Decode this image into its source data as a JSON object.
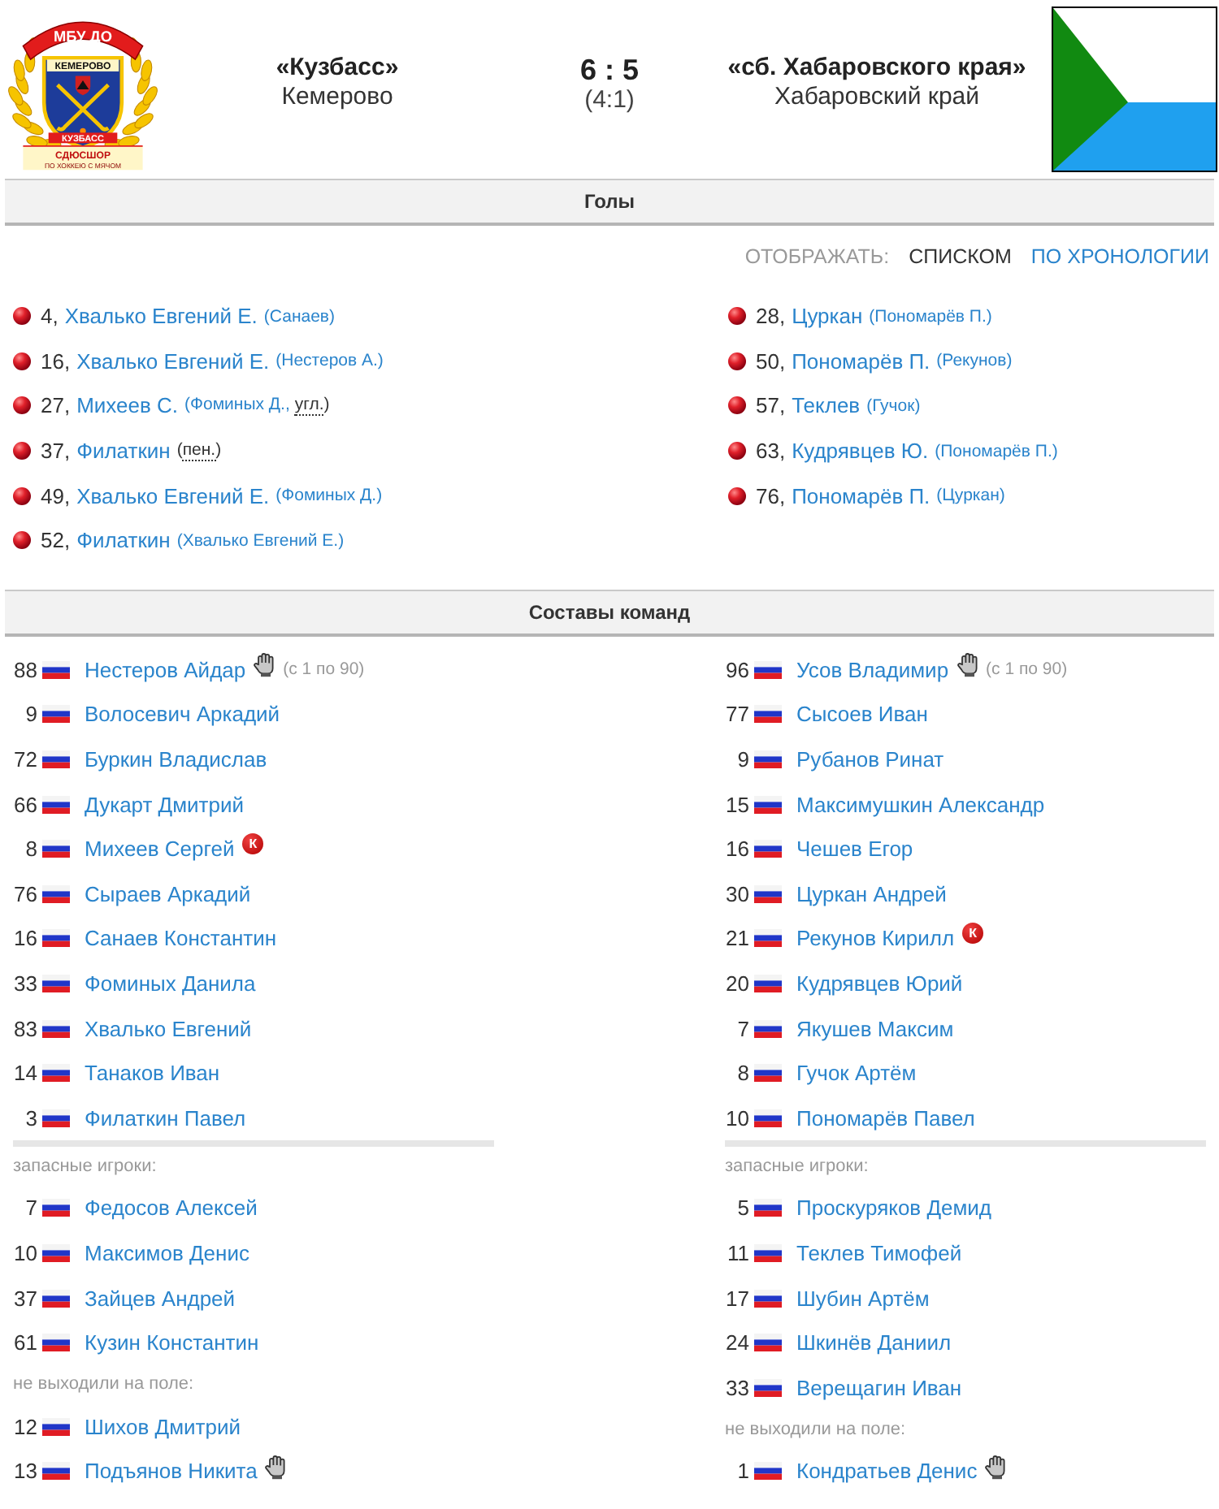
{
  "match": {
    "home": {
      "name": "«Кузбасс»",
      "city": "Кемерово",
      "emblem": {
        "top_ribbon": "МБУ ДО",
        "city_band": "КЕМЕРОВО",
        "bottom_band": "КУЗБАСС",
        "school": "СДЮСШОР",
        "motto": "ПО ХОККЕЮ С МЯЧОМ"
      }
    },
    "score": "6 : 5",
    "halftime": "(4:1)",
    "away": {
      "name": "«сб. Хабаровского края»",
      "city": "Хабаровский край"
    }
  },
  "goals": {
    "title": "Голы",
    "view_label": "ОТОБРАЖАТЬ:",
    "view_options": [
      {
        "label": "СПИСКОМ",
        "selected": true
      },
      {
        "label": "ПО ХРОНОЛОГИИ",
        "selected": false
      }
    ],
    "home": [
      {
        "minute": "4,",
        "scorer": "Хвалько Евгений Е.",
        "note": [
          {
            "kind": "assist",
            "text": "(Санаев)"
          }
        ]
      },
      {
        "minute": "16,",
        "scorer": "Хвалько Евгений Е.",
        "note": [
          {
            "kind": "assist",
            "text": "(Нестеров А.)"
          }
        ]
      },
      {
        "minute": "27,",
        "scorer": "Михеев С.",
        "note": [
          {
            "kind": "assist",
            "text": "(Фоминых Д.,"
          },
          {
            "kind": "abbr",
            "text": "угл."
          },
          {
            "kind": "text",
            "text": ")"
          }
        ]
      },
      {
        "minute": "37,",
        "scorer": "Филаткин",
        "note": [
          {
            "kind": "text",
            "text": "("
          },
          {
            "kind": "abbr",
            "text": "пен."
          },
          {
            "kind": "text",
            "text": ")"
          }
        ]
      },
      {
        "minute": "49,",
        "scorer": "Хвалько Евгений Е.",
        "note": [
          {
            "kind": "assist",
            "text": "(Фоминых Д.)"
          }
        ]
      },
      {
        "minute": "52,",
        "scorer": "Филаткин",
        "note": [
          {
            "kind": "assist",
            "text": "(Хвалько Евгений Е.)"
          }
        ]
      }
    ],
    "away": [
      {
        "minute": "28,",
        "scorer": "Цуркан",
        "note": [
          {
            "kind": "assist",
            "text": "(Пономарёв П.)"
          }
        ]
      },
      {
        "minute": "50,",
        "scorer": "Пономарёв П.",
        "note": [
          {
            "kind": "assist",
            "text": "(Рекунов)"
          }
        ]
      },
      {
        "minute": "57,",
        "scorer": "Теклев",
        "note": [
          {
            "kind": "assist",
            "text": "(Гучок)"
          }
        ]
      },
      {
        "minute": "63,",
        "scorer": "Кудрявцев Ю.",
        "note": [
          {
            "kind": "assist",
            "text": "(Пономарёв П.)"
          }
        ]
      },
      {
        "minute": "76,",
        "scorer": "Пономарёв П.",
        "note": [
          {
            "kind": "assist",
            "text": "(Цуркан)"
          }
        ]
      }
    ]
  },
  "lineups": {
    "title": "Составы команд",
    "teams": [
      {
        "groups": [
          {
            "kind": "starters",
            "players": [
              {
                "number": "88",
                "name": "Нестеров Айдар",
                "goalkeeper": true,
                "time": "(с 1 по 90)"
              },
              {
                "number": "9",
                "name": "Волосевич Аркадий",
                "goalkeeper": false
              },
              {
                "number": "72",
                "name": "Буркин Владислав",
                "goalkeeper": false
              },
              {
                "number": "66",
                "name": "Дукарт Дмитрий",
                "goalkeeper": false
              },
              {
                "number": "8",
                "name": "Михеев Сергей",
                "goalkeeper": false,
                "badge": "К"
              },
              {
                "number": "76",
                "name": "Сыраев Аркадий",
                "goalkeeper": false
              },
              {
                "number": "16",
                "name": "Санаев Константин",
                "goalkeeper": false
              },
              {
                "number": "33",
                "name": "Фоминых Данила",
                "goalkeeper": false
              },
              {
                "number": "83",
                "name": "Хвалько Евгений",
                "goalkeeper": false
              },
              {
                "number": "14",
                "name": "Танаков Иван",
                "goalkeeper": false
              },
              {
                "number": "3",
                "name": "Филаткин Павел",
                "goalkeeper": false
              }
            ]
          },
          {
            "kind": "subs",
            "label": "запасные игроки:",
            "players": [
              {
                "number": "7",
                "name": "Федосов Алексей",
                "goalkeeper": false
              },
              {
                "number": "10",
                "name": "Максимов Денис",
                "goalkeeper": false
              },
              {
                "number": "37",
                "name": "Зайцев Андрей",
                "goalkeeper": false
              },
              {
                "number": "61",
                "name": "Кузин Константин",
                "goalkeeper": false
              }
            ]
          },
          {
            "kind": "unused",
            "label": "не выходили на поле:",
            "players": [
              {
                "number": "12",
                "name": "Шихов Дмитрий",
                "goalkeeper": false
              },
              {
                "number": "13",
                "name": "Подъянов Никита",
                "goalkeeper": true
              }
            ]
          }
        ]
      },
      {
        "groups": [
          {
            "kind": "starters",
            "players": [
              {
                "number": "96",
                "name": "Усов Владимир",
                "goalkeeper": true,
                "time": "(с 1 по 90)"
              },
              {
                "number": "77",
                "name": "Сысоев Иван",
                "goalkeeper": false
              },
              {
                "number": "9",
                "name": "Рубанов Ринат",
                "goalkeeper": false
              },
              {
                "number": "15",
                "name": "Максимушкин Александр",
                "goalkeeper": false
              },
              {
                "number": "16",
                "name": "Чешев Егор",
                "goalkeeper": false
              },
              {
                "number": "30",
                "name": "Цуркан Андрей",
                "goalkeeper": false
              },
              {
                "number": "21",
                "name": "Рекунов Кирилл",
                "goalkeeper": false,
                "badge": "К"
              },
              {
                "number": "20",
                "name": "Кудрявцев Юрий",
                "goalkeeper": false
              },
              {
                "number": "7",
                "name": "Якушев Максим",
                "goalkeeper": false
              },
              {
                "number": "8",
                "name": "Гучок Артём",
                "goalkeeper": false
              },
              {
                "number": "10",
                "name": "Пономарёв Павел",
                "goalkeeper": false
              }
            ]
          },
          {
            "kind": "subs",
            "label": "запасные игроки:",
            "players": [
              {
                "number": "5",
                "name": "Проскуряков Демид",
                "goalkeeper": false
              },
              {
                "number": "11",
                "name": "Теклев Тимофей",
                "goalkeeper": false
              },
              {
                "number": "17",
                "name": "Шубин Артём",
                "goalkeeper": false
              },
              {
                "number": "24",
                "name": "Шкинёв Даниил",
                "goalkeeper": false
              },
              {
                "number": "33",
                "name": "Верещагин Иван",
                "goalkeeper": false
              }
            ]
          },
          {
            "kind": "unused",
            "label": "не выходили на поле:",
            "players": [
              {
                "number": "1",
                "name": "Кондратьев Денис",
                "goalkeeper": true
              }
            ]
          }
        ]
      }
    ]
  }
}
